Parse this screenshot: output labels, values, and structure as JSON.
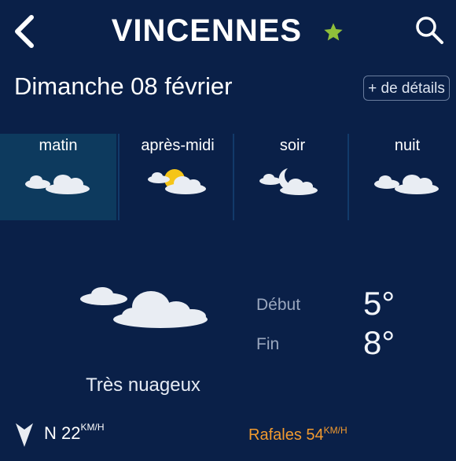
{
  "header": {
    "title": "VINCENNES"
  },
  "date_row": {
    "date": "Dimanche 08 février",
    "details_label": "+ de détails"
  },
  "periods": [
    {
      "label": "matin",
      "icon": "cloudy-icon",
      "active": true
    },
    {
      "label": "après-midi",
      "icon": "partly-sunny-icon",
      "active": false
    },
    {
      "label": "soir",
      "icon": "night-cloudy-icon",
      "active": false
    },
    {
      "label": "nuit",
      "icon": "cloudy-icon",
      "active": false
    }
  ],
  "forecast": {
    "condition": "Très nuageux",
    "start_label": "Début",
    "start_temp": "5°",
    "end_label": "Fin",
    "end_temp": "8°"
  },
  "wind": {
    "direction": "N",
    "speed": "22",
    "unit": "KM/H",
    "gusts_label": "Rafales",
    "gusts_speed": "54",
    "gusts_unit": "KM/H"
  },
  "colors": {
    "background": "#0a2048",
    "active_period": "#0d3a5e",
    "favorite_star": "#8fbf3a",
    "gusts": "#f29a2e"
  }
}
